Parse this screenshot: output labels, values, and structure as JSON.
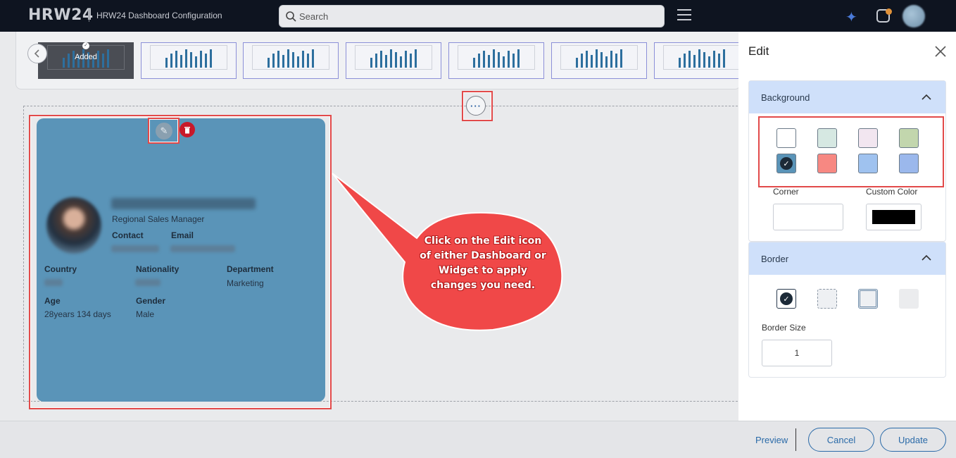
{
  "header": {
    "logo": "HRW24",
    "app_title": "HRW24 Dashboard Configuration",
    "search_placeholder": "Search"
  },
  "widget_strip": {
    "added_label": "Added",
    "thumbnail_count": 7
  },
  "card": {
    "job_title": "Regional Sales Manager",
    "contact_label": "Contact",
    "email_label": "Email",
    "country_label": "Country",
    "nationality_label": "Nationality",
    "department_label": "Department",
    "department_value": "Marketing",
    "age_label": "Age",
    "age_value": "28years 134 days",
    "gender_label": "Gender",
    "gender_value": "Male"
  },
  "callout": {
    "text": "Click on the Edit icon of either Dashboard or Widget to apply changes you need."
  },
  "footer": {
    "preview": "Preview",
    "cancel": "Cancel",
    "update": "Update"
  },
  "edit_panel": {
    "title": "Edit",
    "background": {
      "heading": "Background",
      "swatches": [
        "#ffffff",
        "#d6e8e2",
        "#f2e6f0",
        "#c2d6ad",
        "#5a94b8",
        "#f78882",
        "#9fc2ef",
        "#9bb8ec"
      ],
      "selected_index": 4,
      "corner_label": "Corner",
      "custom_color_label": "Custom Color",
      "custom_color_value": "#000000"
    },
    "border": {
      "heading": "Border",
      "styles": [
        "solid",
        "dashed",
        "double",
        "none"
      ],
      "selected_index": 0,
      "border_size_label": "Border Size",
      "border_size_value": "1"
    }
  },
  "colors": {
    "topbar": "#0e1420",
    "accent": "#2a6aa8",
    "highlight": "#e24a4a",
    "card_bg": "#5a94b8",
    "section_header": "#cfe0fa"
  }
}
